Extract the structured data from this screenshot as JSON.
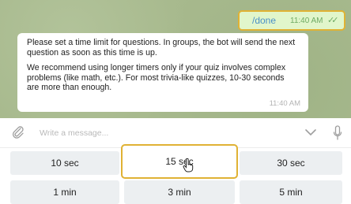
{
  "chat": {
    "outgoing": {
      "text": "/done",
      "time": "11:40 AM",
      "status": "✓✓"
    },
    "incoming": {
      "paragraph_1": "Please set a time limit for questions. In groups, the bot will send the next question as soon as this time is up.",
      "paragraph_2": "We recommend using longer timers only if your quiz involves complex problems (like math, etc.). For most trivia-like quizzes, 10-30 seconds are more than enough.",
      "time": "11:40 AM"
    }
  },
  "composer": {
    "placeholder": "Write a message...",
    "icons": [
      "paperclip-icon",
      "chevron-down-icon",
      "microphone-icon"
    ]
  },
  "keyboard": {
    "rows": [
      [
        "10 sec",
        "15 sec",
        "30 sec"
      ],
      [
        "1 min",
        "3 min",
        "5 min"
      ]
    ],
    "highlighted": "15 sec"
  },
  "colors": {
    "highlight_border": "#e0b234",
    "outgoing_bubble": "#e1f6cb",
    "link": "#4a90c8",
    "key_bg": "#eceff1",
    "chat_bg": "#a7b98d"
  }
}
